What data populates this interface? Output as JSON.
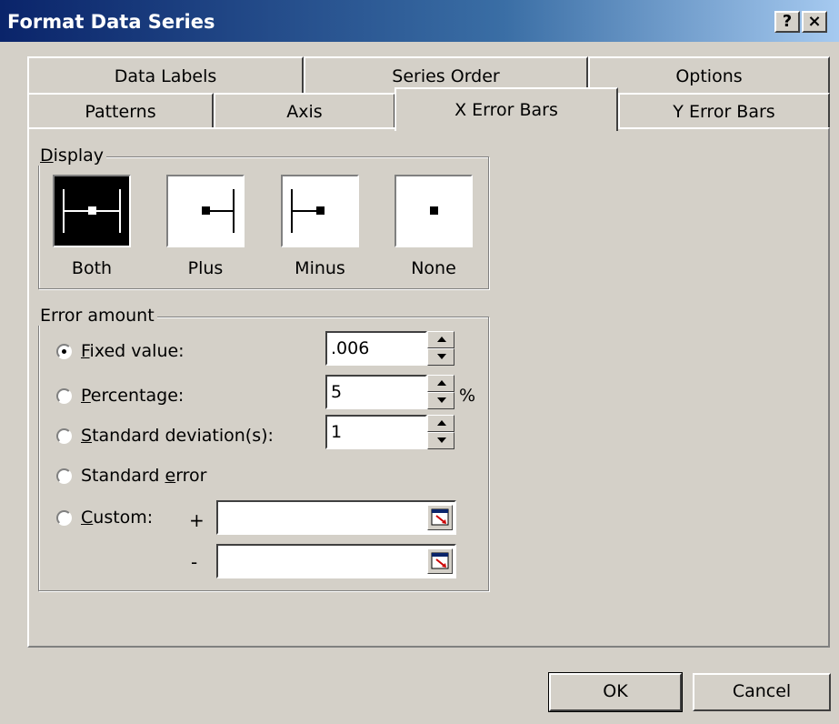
{
  "window": {
    "title": "Format Data Series",
    "help_label": "?",
    "close_label": "×"
  },
  "tabs": {
    "row_back": [
      {
        "label": "Data Labels"
      },
      {
        "label": "Series Order"
      },
      {
        "label": "Options"
      }
    ],
    "row_front": [
      {
        "label": "Patterns"
      },
      {
        "label": "Axis"
      },
      {
        "label": "X Error Bars"
      },
      {
        "label": "Y Error Bars"
      }
    ],
    "active": "X Error Bars"
  },
  "display": {
    "title_prefix": "D",
    "title_rest": "isplay",
    "options": [
      {
        "label": "Both",
        "icon": "error-bar-both-icon",
        "selected": true
      },
      {
        "label": "Plus",
        "icon": "error-bar-plus-icon",
        "selected": false
      },
      {
        "label": "Minus",
        "icon": "error-bar-minus-icon",
        "selected": false
      },
      {
        "label": "None",
        "icon": "error-bar-none-icon",
        "selected": false
      }
    ]
  },
  "error_amount": {
    "title": "Error amount",
    "fixed": {
      "accel": "F",
      "rest": "ixed value:",
      "value": ".006",
      "checked": true
    },
    "percentage": {
      "accel": "P",
      "rest": "ercentage:",
      "value": "5",
      "unit": "%",
      "checked": false
    },
    "stddev": {
      "accel": "S",
      "rest": "tandard deviation(s):",
      "value": "1",
      "checked": false
    },
    "stderr": {
      "pre": "Standard ",
      "accel": "e",
      "rest": "rror",
      "checked": false
    },
    "custom": {
      "accel": "C",
      "rest": "ustom:",
      "plus_label": "+",
      "minus_label": "-",
      "plus_value": "",
      "minus_value": "",
      "checked": false
    }
  },
  "buttons": {
    "ok": "OK",
    "cancel": "Cancel"
  }
}
